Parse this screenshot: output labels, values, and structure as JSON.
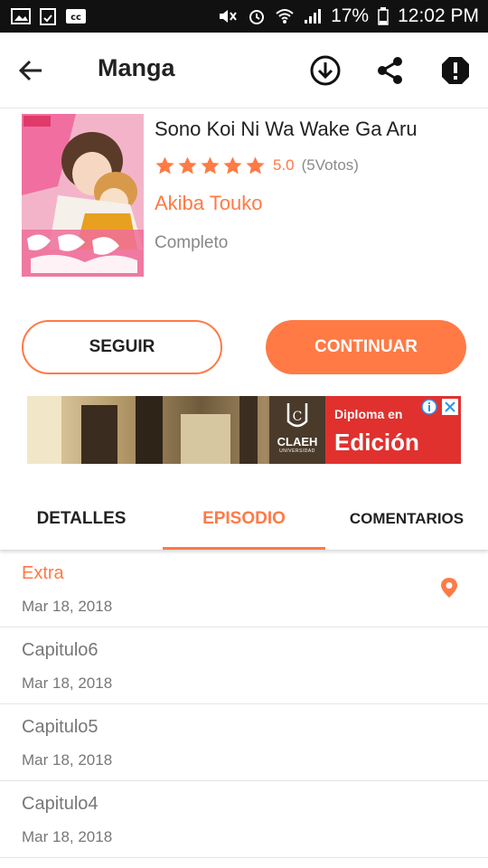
{
  "status_bar": {
    "battery": "17%",
    "time": "12:02 PM",
    "icons": [
      "image-icon",
      "clipboard-icon",
      "cc-icon",
      "mute-icon",
      "alarm-icon",
      "wifi-icon",
      "signal-icon",
      "battery-icon"
    ]
  },
  "app_bar": {
    "title": "Manga",
    "icons": [
      "back-arrow-icon",
      "download-icon",
      "share-icon",
      "report-icon"
    ]
  },
  "manga": {
    "title": "Sono Koi Ni Wa Wake Ga Aru",
    "rating": "5.0",
    "rating_value": 5,
    "rating_max": 5,
    "votes": "(5Votos)",
    "author": "Akiba Touko",
    "status": "Completo"
  },
  "buttons": {
    "follow": "SEGUIR",
    "continue": "CONTINUAR"
  },
  "ad": {
    "brand": "CLAEH",
    "brand_sub": "UNIVERSIDAD",
    "line1": "Diploma en",
    "line2": "Edición"
  },
  "tabs": {
    "details": "DETALLES",
    "episode": "EPISODIO",
    "comments": "COMENTARIOS",
    "active": "EPISODIO"
  },
  "episodes": [
    {
      "title": "Extra",
      "date": "Mar 18, 2018",
      "current": true
    },
    {
      "title": "Capitulo6",
      "date": "Mar 18, 2018",
      "current": false
    },
    {
      "title": "Capitulo5",
      "date": "Mar 18, 2018",
      "current": false
    },
    {
      "title": "Capitulo4",
      "date": "Mar 18, 2018",
      "current": false
    }
  ],
  "colors": {
    "accent": "#ff7a45",
    "status_bar": "#111111",
    "text": "#222222",
    "muted": "#777777"
  }
}
